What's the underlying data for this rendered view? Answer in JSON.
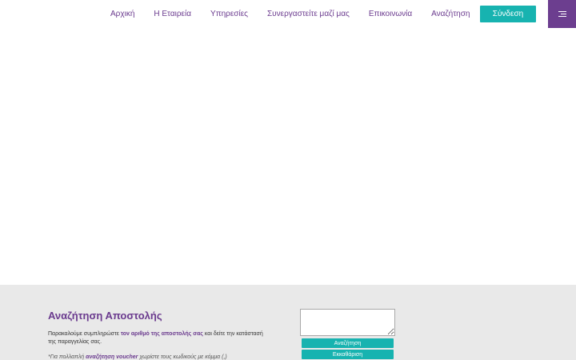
{
  "header": {
    "nav": [
      {
        "label": "Αρχική"
      },
      {
        "label": "Η Εταιρεία"
      },
      {
        "label": "Υπηρεσίες"
      },
      {
        "label": "Συνεργαστείτε μαζί μας"
      },
      {
        "label": "Επικοινωνία"
      },
      {
        "label": "Αναζήτηση"
      }
    ],
    "login_label": "Σύνδεση",
    "menu_icon": "hamburger-icon"
  },
  "tracking": {
    "title": "Αναζήτηση Αποστολής",
    "desc_pre": "Παρακαλούμε συμπληρώστε ",
    "desc_bold": "τον αριθμό της αποστολής σας",
    "desc_post": " και δείτε την κατάστασή της παραγγελίας σας.",
    "note_pre": "*Για πολλαπλή ",
    "note_bold": "αναζήτηση voucher",
    "note_post": " χωρίστε τους κωδικούς με κόμμα (,)",
    "input_value": "",
    "search_label": "Αναζήτηση",
    "clear_label": "Εκκαθάριση"
  },
  "colors": {
    "brand_purple": "#6c3e8f",
    "accent_teal": "#17b3b0",
    "section_bg": "#e9e9e9"
  }
}
